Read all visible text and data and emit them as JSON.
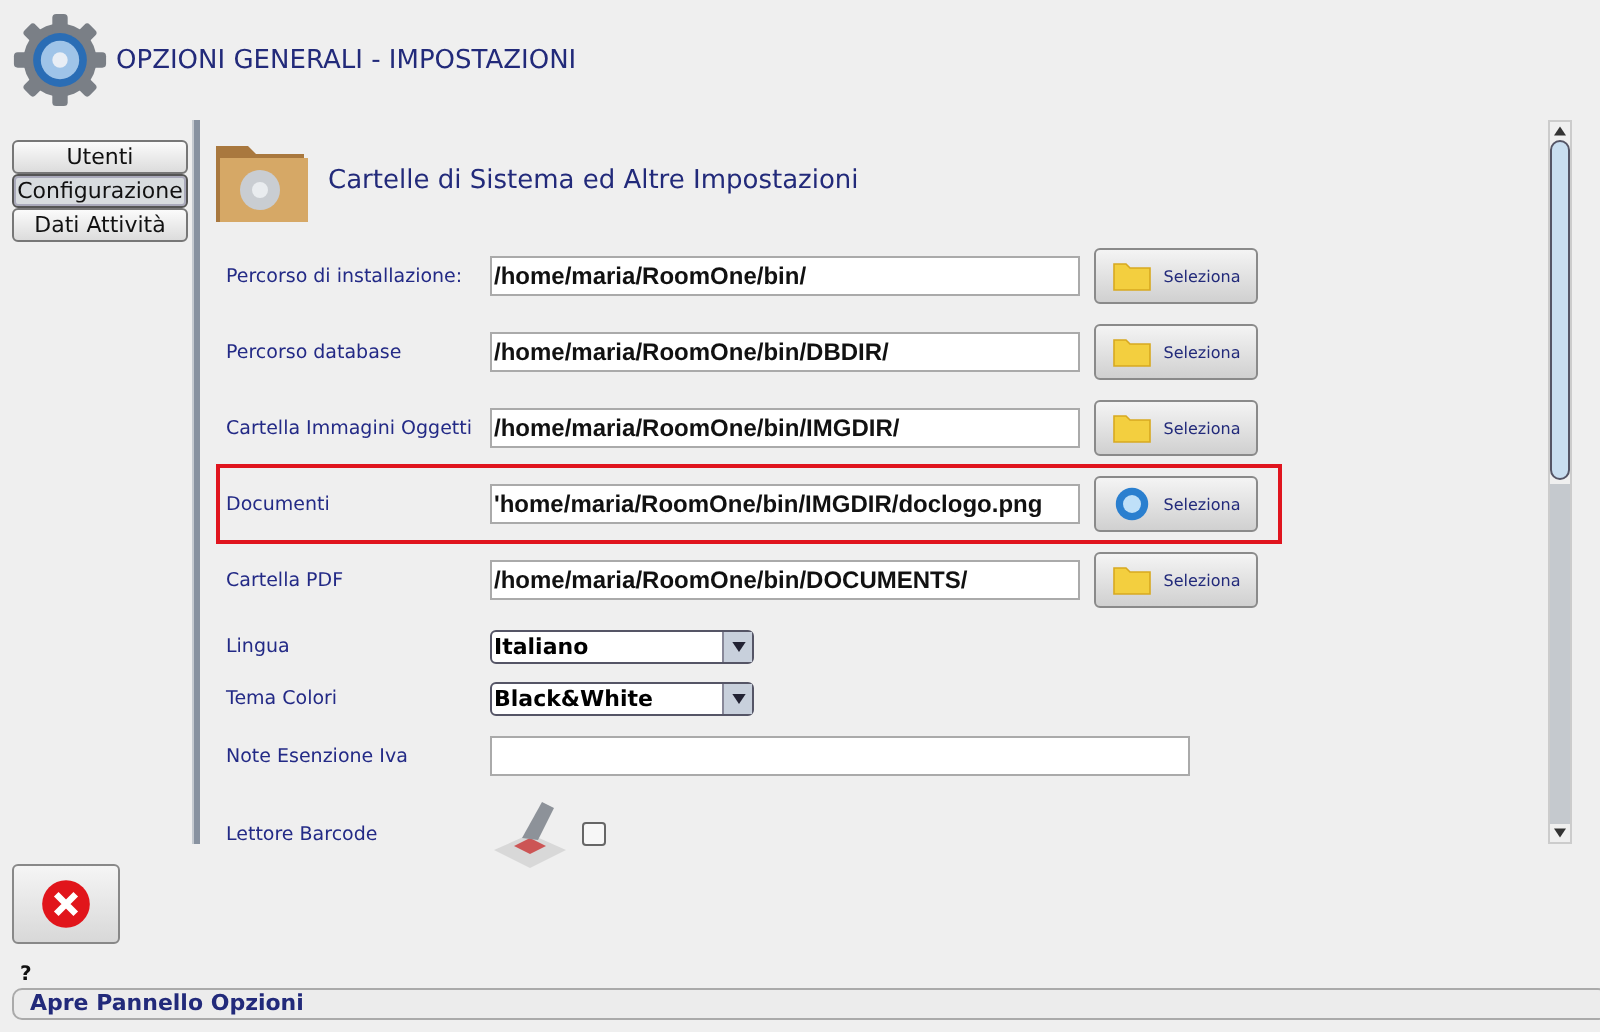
{
  "window": {
    "title": "OPZIONI GENERALI - IMPOSTAZIONI"
  },
  "tabs": [
    {
      "label": "Utenti",
      "selected": false
    },
    {
      "label": "Configurazione",
      "selected": true
    },
    {
      "label": "Dati Attività",
      "selected": false
    }
  ],
  "section": {
    "title": "Cartelle di Sistema ed Altre Impostazioni"
  },
  "fields": [
    {
      "kind": "path",
      "label": "Percorso di installazione:",
      "value": "/home/maria/RoomOne/bin/",
      "button": "Seleziona",
      "highlighted": false
    },
    {
      "kind": "path",
      "label": "Percorso database",
      "value": "/home/maria/RoomOne/bin/DBDIR/",
      "button": "Seleziona",
      "highlighted": false
    },
    {
      "kind": "path",
      "label": "Cartella Immagini Oggetti",
      "value": "/home/maria/RoomOne/bin/IMGDIR/",
      "button": "Seleziona",
      "highlighted": false
    },
    {
      "kind": "path",
      "label": "Documenti",
      "value": "'home/maria/RoomOne/bin/IMGDIR/doclogo.png",
      "button": "Seleziona",
      "highlighted": true
    },
    {
      "kind": "path",
      "label": "Cartella PDF",
      "value": "/home/maria/RoomOne/bin/DOCUMENTS/",
      "button": "Seleziona",
      "highlighted": false
    },
    {
      "kind": "select",
      "label": "Lingua",
      "value": "Italiano"
    },
    {
      "kind": "select",
      "label": "Tema Colori",
      "value": "Black&White"
    },
    {
      "kind": "text",
      "label": "Note Esenzione Iva"
    },
    {
      "kind": "checkbox",
      "label": "Lettore Barcode",
      "checked": false
    }
  ],
  "help": "?",
  "status_bar": "Apre Pannello Opzioni"
}
